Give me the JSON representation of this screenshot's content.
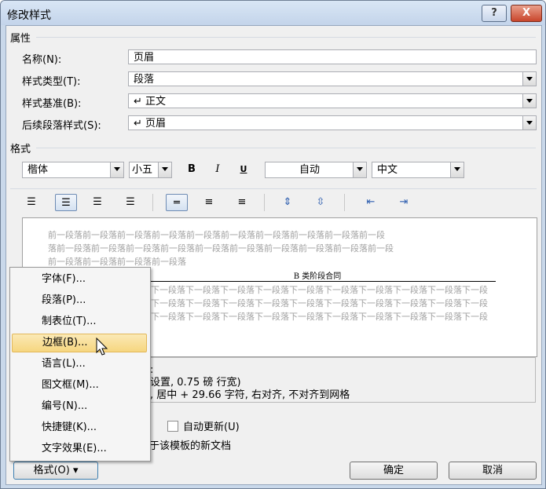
{
  "title": "修改样式",
  "title_buttons": {
    "help": "?",
    "close": "X"
  },
  "properties": {
    "group_label": "属性",
    "name_label": "名称(N):",
    "name_value": "页眉",
    "type_label": "样式类型(T):",
    "type_value": "段落",
    "base_label": "样式基准(B):",
    "base_value": "↵ 正文",
    "next_label": "后续段落样式(S):",
    "next_value": "↵ 页眉"
  },
  "format": {
    "group_label": "格式",
    "font": "楷体",
    "size": "小五",
    "bold": "B",
    "italic": "I",
    "underline": "U",
    "color": "自动",
    "script": "中文"
  },
  "preview": {
    "prev_lines": [
      "前一段落前一段落前一段落前一段落前一段落前一段落前一段落前一段落前一段落前一段",
      "落前一段落前一段落前一段落前一段落前一段落前一段落前一段落前一段落前一段落前一段",
      "前一段落前一段落前一段落前一段落"
    ],
    "sample_text": "B 类阶段合同",
    "next_lines": [
      "落下一段落下一段落下一段落下一段落下一段落下一段落下一段落下一段落下一段落下一段",
      "段落下一段落下一段落下一段落下一段落下一段落下一段落下一段落下一段落下一段落下一段",
      "段落下一段落下一段落下一段落下一段落下一段落下一段落下一段落下一段落下一段落下一段"
    ]
  },
  "description": {
    "line1": "框:",
    "line2": "动设置,  0.75 磅 行宽)",
    "line3": "符, 居中 +   29.66 字符, 右对齐, 不对齐到网格"
  },
  "options": {
    "auto_update": "自动更新(U)",
    "template_partial": "于该模板的新文档"
  },
  "menu_items": [
    "字体(F)...",
    "段落(P)...",
    "制表位(T)...",
    "边框(B)...",
    "语言(L)...",
    "图文框(M)...",
    "编号(N)...",
    "快捷键(K)...",
    "文字效果(E)..."
  ],
  "buttons": {
    "format": "格式(O) ▾",
    "ok": "确定",
    "cancel": "取消"
  }
}
